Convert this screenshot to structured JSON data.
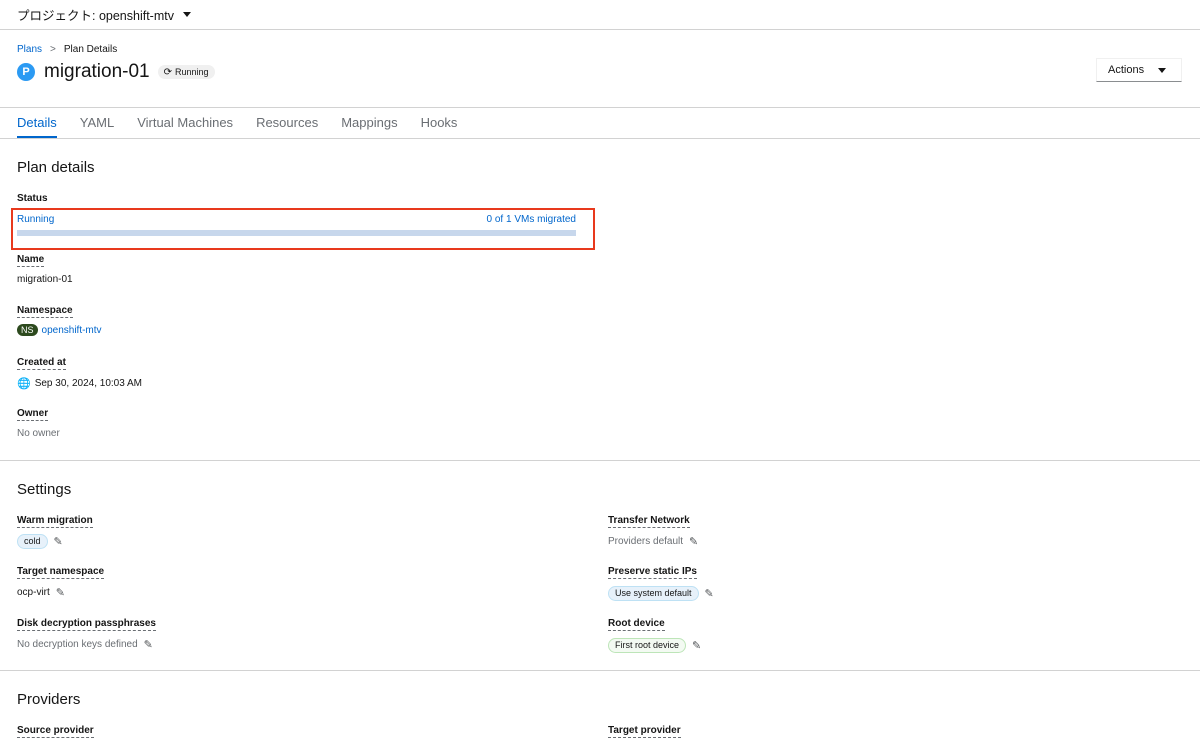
{
  "project_bar": {
    "label": "プロジェクト: openshift-mtv"
  },
  "breadcrumb": {
    "root": "Plans",
    "separator": ">",
    "current": "Plan Details"
  },
  "header": {
    "badge": "P",
    "title": "migration-01",
    "status": "Running",
    "status_icon": "sync-icon",
    "actions_label": "Actions"
  },
  "tabs": [
    {
      "label": "Details",
      "active": true
    },
    {
      "label": "YAML",
      "active": false
    },
    {
      "label": "Virtual Machines",
      "active": false
    },
    {
      "label": "Resources",
      "active": false
    },
    {
      "label": "Mappings",
      "active": false
    },
    {
      "label": "Hooks",
      "active": false
    }
  ],
  "plan_details": {
    "title": "Plan details",
    "status_label": "Status",
    "status_value": "Running",
    "migrated_text": "0 of 1 VMs migrated",
    "progress_fraction": 0,
    "name_label": "Name",
    "name_value": "migration-01",
    "namespace_label": "Namespace",
    "namespace_badge": "NS",
    "namespace_value": "openshift-mtv",
    "created_label": "Created at",
    "created_value": "Sep 30, 2024, 10:03 AM",
    "owner_label": "Owner",
    "owner_value": "No owner"
  },
  "settings": {
    "title": "Settings",
    "warm_label": "Warm migration",
    "warm_value": "cold",
    "target_ns_label": "Target namespace",
    "target_ns_value": "ocp-virt",
    "disk_label": "Disk decryption passphrases",
    "disk_value": "No decryption keys defined",
    "transfer_label": "Transfer Network",
    "transfer_value": "Providers default",
    "preserve_label": "Preserve static IPs",
    "preserve_value": "Use system default",
    "root_label": "Root device",
    "root_value": "First root device"
  },
  "providers": {
    "title": "Providers",
    "source_label": "Source provider",
    "target_label": "Target provider"
  },
  "colors": {
    "accent": "#0066cc",
    "highlight_box": "#e8391d",
    "progress_track": "#c7d7ec"
  }
}
